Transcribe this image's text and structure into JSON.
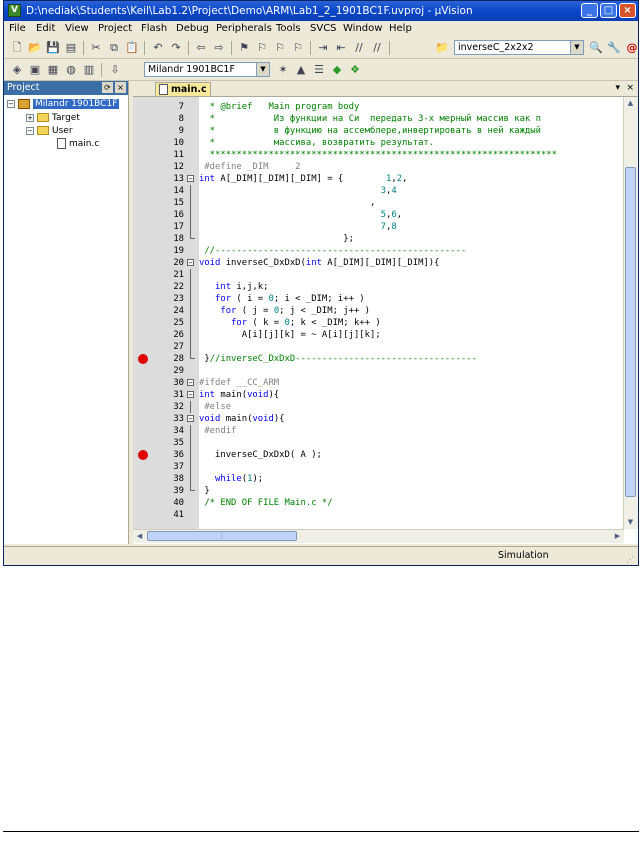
{
  "window": {
    "title": "D:\\nediak\\Students\\Keil\\Lab1.2\\Project\\Demo\\ARM\\Lab1_2_1901BC1F.uvproj - µVision",
    "app_icon_glyph": "V"
  },
  "menu": [
    "File",
    "Edit",
    "View",
    "Project",
    "Flash",
    "Debug",
    "Peripherals",
    "Tools",
    "SVCS",
    "Window",
    "Help"
  ],
  "toolbar": {
    "function_combo": "inverseC_2x2x2",
    "target_combo": "Milandr 1901BC1F"
  },
  "project": {
    "header": "Project",
    "root": "Milandr 1901BC1F",
    "groups": [
      "Target",
      "User"
    ],
    "file": "main.c"
  },
  "editor": {
    "tab": "main.c",
    "lines": [
      {
        "n": "7",
        "s": [
          [
            "cm",
            "  * @brief   Main program body"
          ]
        ]
      },
      {
        "n": "8",
        "s": [
          [
            "cm",
            "  *           Из функции на Си  передать 3-х мерный массив как п"
          ]
        ]
      },
      {
        "n": "9",
        "s": [
          [
            "cm",
            "  *           в функцию на ассемблере,инвертировать в ней каждый"
          ]
        ]
      },
      {
        "n": "10",
        "s": [
          [
            "cm",
            "  *           массива, возвратить результат."
          ]
        ]
      },
      {
        "n": "11",
        "s": [
          [
            "cm",
            "  *****************************************************************"
          ]
        ]
      },
      {
        "n": "12",
        "s": [
          [
            "pp",
            " #define _DIM     2"
          ]
        ]
      },
      {
        "n": "13",
        "fold": "open",
        "s": [
          [
            "kw",
            "int"
          ],
          [
            "tx",
            " A[_DIM][_DIM][_DIM] = {        "
          ],
          [
            "nm",
            "1"
          ],
          [
            "tx",
            ","
          ],
          [
            "nm",
            "2"
          ],
          [
            "tx",
            ","
          ]
        ]
      },
      {
        "n": "14",
        "fold": "line",
        "s": [
          [
            "tx",
            "                                  "
          ],
          [
            "nm",
            "3"
          ],
          [
            "tx",
            ","
          ],
          [
            "nm",
            "4"
          ]
        ]
      },
      {
        "n": "15",
        "fold": "line",
        "s": [
          [
            "tx",
            "                                ,"
          ]
        ]
      },
      {
        "n": "16",
        "fold": "line",
        "s": [
          [
            "tx",
            "                                  "
          ],
          [
            "nm",
            "5"
          ],
          [
            "tx",
            ","
          ],
          [
            "nm",
            "6"
          ],
          [
            "tx",
            ","
          ]
        ]
      },
      {
        "n": "17",
        "fold": "line",
        "s": [
          [
            "tx",
            "                                  "
          ],
          [
            "nm",
            "7"
          ],
          [
            "tx",
            ","
          ],
          [
            "nm",
            "8"
          ]
        ]
      },
      {
        "n": "18",
        "fold": "end",
        "s": [
          [
            "tx",
            "                           };"
          ]
        ]
      },
      {
        "n": "19",
        "s": [
          [
            "cm",
            " //-----------------------------------------------"
          ]
        ]
      },
      {
        "n": "20",
        "fold": "open",
        "s": [
          [
            "kw",
            "void"
          ],
          [
            "tx",
            " inverseC_DxDxD("
          ],
          [
            "kw",
            "int"
          ],
          [
            "tx",
            " A[_DIM][_DIM][_DIM]){"
          ]
        ]
      },
      {
        "n": "21",
        "fold": "line",
        "s": [
          [
            "tx",
            ""
          ]
        ]
      },
      {
        "n": "22",
        "fold": "line",
        "s": [
          [
            "tx",
            "   "
          ],
          [
            "kw",
            "int"
          ],
          [
            "tx",
            " i,j,k;"
          ]
        ]
      },
      {
        "n": "23",
        "fold": "line",
        "s": [
          [
            "tx",
            "   "
          ],
          [
            "kw",
            "for"
          ],
          [
            "tx",
            " ( i = "
          ],
          [
            "nm",
            "0"
          ],
          [
            "tx",
            "; i < _DIM; i++ )"
          ]
        ]
      },
      {
        "n": "24",
        "fold": "line",
        "s": [
          [
            "tx",
            "    "
          ],
          [
            "kw",
            "for"
          ],
          [
            "tx",
            " ( j = "
          ],
          [
            "nm",
            "0"
          ],
          [
            "tx",
            "; j < _DIM; j++ )"
          ]
        ]
      },
      {
        "n": "25",
        "fold": "line",
        "s": [
          [
            "tx",
            "      "
          ],
          [
            "kw",
            "for"
          ],
          [
            "tx",
            " ( k = "
          ],
          [
            "nm",
            "0"
          ],
          [
            "tx",
            "; k < _DIM; k++ )"
          ]
        ]
      },
      {
        "n": "26",
        "fold": "line",
        "s": [
          [
            "tx",
            "        A[i][j][k] = ~ A[i][j][k];"
          ]
        ]
      },
      {
        "n": "27",
        "fold": "line",
        "s": [
          [
            "tx",
            ""
          ]
        ]
      },
      {
        "n": "28",
        "bp": true,
        "fold": "end",
        "s": [
          [
            "tx",
            " }"
          ],
          [
            "cm",
            "//inverseC_DxDxD----------------------------------"
          ]
        ]
      },
      {
        "n": "29",
        "s": [
          [
            "tx",
            ""
          ]
        ]
      },
      {
        "n": "30",
        "fold": "open",
        "s": [
          [
            "pp",
            "#ifdef __CC_ARM"
          ]
        ]
      },
      {
        "n": "31",
        "fold": "open",
        "s": [
          [
            "kw",
            "int"
          ],
          [
            "tx",
            " main("
          ],
          [
            "kw",
            "void"
          ],
          [
            "tx",
            "){"
          ]
        ]
      },
      {
        "n": "32",
        "fold": "line",
        "s": [
          [
            "pp",
            " #else"
          ]
        ]
      },
      {
        "n": "33",
        "fold": "open",
        "s": [
          [
            "kw",
            "void"
          ],
          [
            "tx",
            " main("
          ],
          [
            "kw",
            "void"
          ],
          [
            "tx",
            "){"
          ]
        ]
      },
      {
        "n": "34",
        "fold": "line",
        "s": [
          [
            "pp",
            " #endif"
          ]
        ]
      },
      {
        "n": "35",
        "fold": "line",
        "s": [
          [
            "tx",
            ""
          ]
        ]
      },
      {
        "n": "36",
        "bp": true,
        "fold": "line",
        "s": [
          [
            "tx",
            "   inverseC_DxDxD( A );"
          ]
        ]
      },
      {
        "n": "37",
        "fold": "line",
        "s": [
          [
            "tx",
            ""
          ]
        ]
      },
      {
        "n": "38",
        "fold": "line",
        "s": [
          [
            "tx",
            "   "
          ],
          [
            "kw",
            "while"
          ],
          [
            "tx",
            "("
          ],
          [
            "nm",
            "1"
          ],
          [
            "tx",
            ");"
          ]
        ]
      },
      {
        "n": "39",
        "fold": "end",
        "s": [
          [
            "tx",
            " }"
          ]
        ]
      },
      {
        "n": "40",
        "s": [
          [
            "cm",
            " /* END OF FILE Main.c */"
          ]
        ]
      },
      {
        "n": "41",
        "s": [
          [
            "tx",
            ""
          ]
        ]
      }
    ]
  },
  "status": {
    "mode": "Simulation"
  },
  "colors": {
    "keyword": "#0000ff",
    "comment": "#008000",
    "number": "#008080",
    "preprocessor": "#808080",
    "breakpoint": "#e00000"
  },
  "icons": {
    "toolbar1": [
      "new-file-icon",
      "open-folder-icon",
      "save-icon",
      "save-all-icon",
      "cut-icon",
      "copy-icon",
      "paste-icon",
      "undo-icon",
      "redo-icon",
      "nav-back-icon",
      "nav-forward-icon",
      "bookmark-icon",
      "bookmark-prev-icon",
      "bookmark-next-icon",
      "bookmark-clear-icon",
      "indent-icon",
      "unindent-icon",
      "comment-icon",
      "uncomment-icon",
      "find-in-files-icon"
    ],
    "toolbar2": [
      "translate-icon",
      "build-icon",
      "rebuild-icon",
      "batch-build-icon",
      "stop-build-icon",
      "download-icon"
    ]
  }
}
